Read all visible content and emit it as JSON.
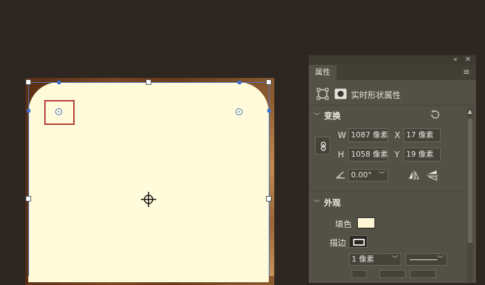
{
  "panel": {
    "tab_title": "属性",
    "collapse_glyph": "«",
    "close_glyph": "✕",
    "menu_glyph": "≡",
    "subtitle": "实时形状属性"
  },
  "transform": {
    "section_title": "变换",
    "w_label": "W",
    "w_value": "1087 像素",
    "x_label": "X",
    "x_value": "17 像素",
    "h_label": "H",
    "h_value": "1058 像素",
    "y_label": "Y",
    "y_value": "19 像素",
    "angle_value": "0.00°"
  },
  "appearance": {
    "section_title": "外观",
    "fill_label": "填色",
    "fill_color": "#fff6d5",
    "stroke_label": "描边",
    "stroke_width_value": "1 像素"
  },
  "colors": {
    "canvas_bg": "#2e2620",
    "shape_fill": "#fffad9",
    "highlight": "#b43a32",
    "selection": "#4a78c9"
  }
}
